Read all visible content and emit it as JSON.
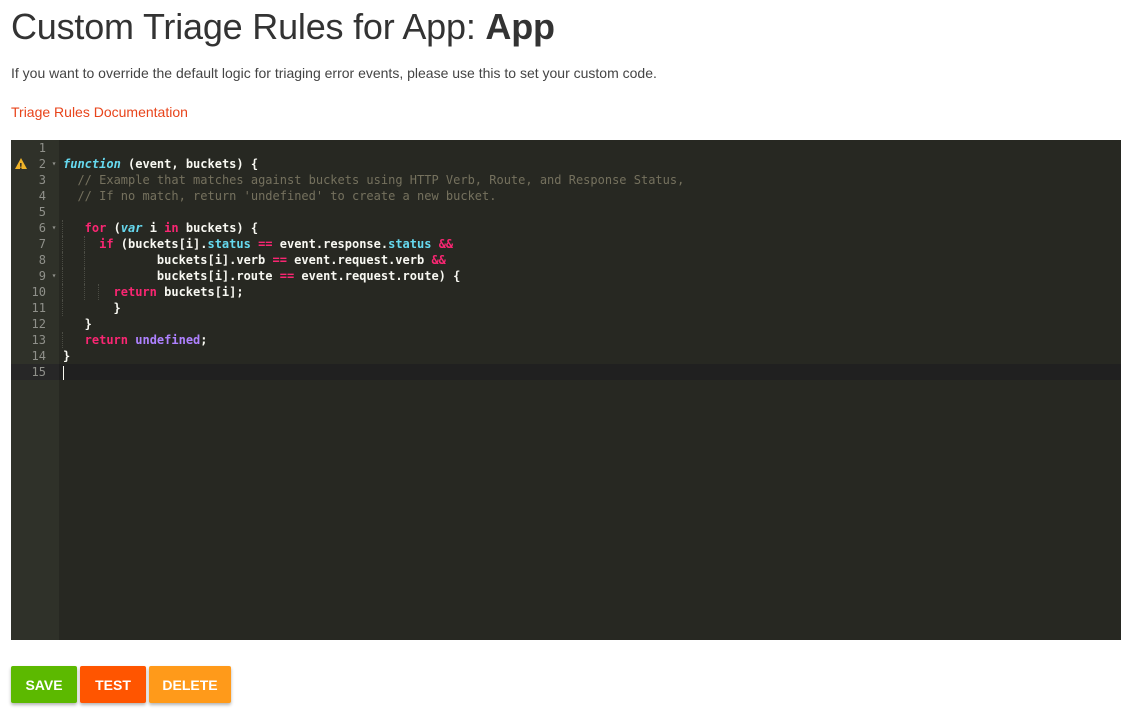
{
  "header": {
    "title_prefix": "Custom Triage Rules for App: ",
    "app_name": "App",
    "description": "If you want to override the default logic for triaging error events, please use this to set your custom code.",
    "doc_link": "Triage Rules Documentation"
  },
  "editor": {
    "warning_line": 2,
    "active_line": 15,
    "fold_lines": [
      2,
      6,
      9
    ],
    "colors": {
      "background": "#272822",
      "keyword": "#f92672",
      "storage": "#66d9ef",
      "comment": "#75715e",
      "constant": "#ae81ff",
      "plain": "#f8f8f2"
    },
    "lines": [
      [],
      [
        [
          "function",
          "sto-it"
        ],
        [
          " (event, buckets) {",
          "p"
        ]
      ],
      [
        [
          "  // Example that matches against buckets using HTTP Verb, Route, and Response Status,",
          "c"
        ]
      ],
      [
        [
          "  // If no match, return 'undefined' to create a new bucket.",
          "c"
        ]
      ],
      [],
      [
        [
          "   ",
          "g1"
        ],
        [
          "for",
          "k"
        ],
        [
          " (",
          "p"
        ],
        [
          "var",
          "sto-it"
        ],
        [
          " i ",
          "p"
        ],
        [
          "in",
          "k"
        ],
        [
          " buckets) {",
          "p"
        ]
      ],
      [
        [
          "   ",
          "g1"
        ],
        [
          "  ",
          "g1"
        ],
        [
          "if",
          "k"
        ],
        [
          " (buckets[i].",
          "p"
        ],
        [
          "status",
          "sto"
        ],
        [
          " ",
          "p"
        ],
        [
          "==",
          "k"
        ],
        [
          " event.response.",
          "p"
        ],
        [
          "status",
          "sto"
        ],
        [
          " ",
          "p"
        ],
        [
          "&&",
          "k"
        ]
      ],
      [
        [
          "   ",
          "g1"
        ],
        [
          "  ",
          "g1"
        ],
        [
          "        buckets[i].verb ",
          "p"
        ],
        [
          "==",
          "k"
        ],
        [
          " event.request.verb ",
          "p"
        ],
        [
          "&&",
          "k"
        ]
      ],
      [
        [
          "   ",
          "g1"
        ],
        [
          "  ",
          "g1"
        ],
        [
          "        buckets[i].route ",
          "p"
        ],
        [
          "==",
          "k"
        ],
        [
          " event.request.route) {",
          "p"
        ]
      ],
      [
        [
          "   ",
          "g1"
        ],
        [
          "  ",
          "g1"
        ],
        [
          "  ",
          "g1"
        ],
        [
          "return",
          "k"
        ],
        [
          " buckets[i];",
          "p"
        ]
      ],
      [
        [
          "   ",
          "g1"
        ],
        [
          "    }",
          "p"
        ]
      ],
      [
        [
          "   }",
          "p"
        ]
      ],
      [
        [
          "   ",
          "g1"
        ],
        [
          "return",
          "k"
        ],
        [
          " ",
          "p"
        ],
        [
          "undefined",
          "con"
        ],
        [
          ";",
          "p"
        ]
      ],
      [
        [
          "}",
          "p"
        ]
      ],
      []
    ]
  },
  "buttons": {
    "save": "SAVE",
    "test": "TEST",
    "delete": "DELETE",
    "save_color": "#5cb900",
    "test_color": "#ff5500",
    "delete_color": "#ff9a1a"
  }
}
